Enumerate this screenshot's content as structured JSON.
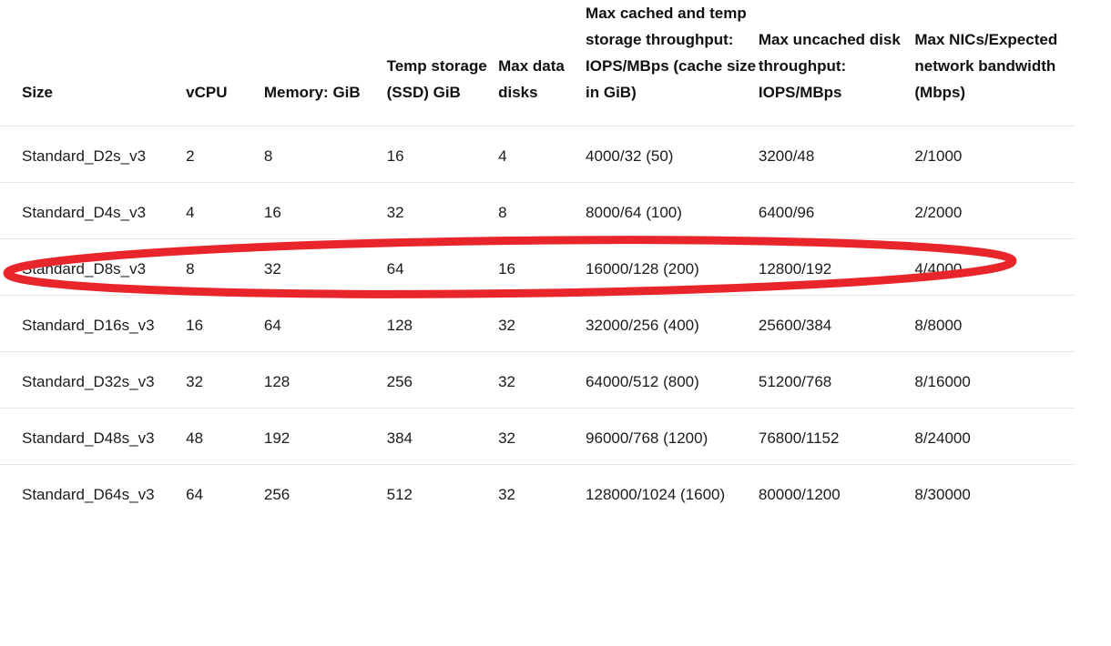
{
  "table": {
    "columns": [
      {
        "key": "size",
        "label": "Size"
      },
      {
        "key": "vcpu",
        "label": "vCPU"
      },
      {
        "key": "memory",
        "label": "Memory: GiB"
      },
      {
        "key": "temp",
        "label": "Temp storage (SSD) GiB"
      },
      {
        "key": "disks",
        "label": "Max data disks"
      },
      {
        "key": "cached",
        "label": "Max cached and temp storage throughput: IOPS/MBps (cache size in GiB)"
      },
      {
        "key": "uncached",
        "label": "Max uncached disk throughput: IOPS/MBps"
      },
      {
        "key": "nics",
        "label": "Max NICs/Expected network bandwidth (Mbps)"
      }
    ],
    "rows": [
      {
        "size": "Standard_D2s_v3",
        "vcpu": "2",
        "memory": "8",
        "temp": "16",
        "disks": "4",
        "cached": "4000/32 (50)",
        "uncached": "3200/48",
        "nics": "2/1000"
      },
      {
        "size": "Standard_D4s_v3",
        "vcpu": "4",
        "memory": "16",
        "temp": "32",
        "disks": "8",
        "cached": "8000/64 (100)",
        "uncached": "6400/96",
        "nics": "2/2000"
      },
      {
        "size": "Standard_D8s_v3",
        "vcpu": "8",
        "memory": "32",
        "temp": "64",
        "disks": "16",
        "cached": "16000/128 (200)",
        "uncached": "12800/192",
        "nics": "4/4000"
      },
      {
        "size": "Standard_D16s_v3",
        "vcpu": "16",
        "memory": "64",
        "temp": "128",
        "disks": "32",
        "cached": "32000/256 (400)",
        "uncached": "25600/384",
        "nics": "8/8000"
      },
      {
        "size": "Standard_D32s_v3",
        "vcpu": "32",
        "memory": "128",
        "temp": "256",
        "disks": "32",
        "cached": "64000/512 (800)",
        "uncached": "51200/768",
        "nics": "8/16000"
      },
      {
        "size": "Standard_D48s_v3",
        "vcpu": "48",
        "memory": "192",
        "temp": "384",
        "disks": "32",
        "cached": "96000/768 (1200)",
        "uncached": "76800/1152",
        "nics": "8/24000"
      },
      {
        "size": "Standard_D64s_v3",
        "vcpu": "64",
        "memory": "256",
        "temp": "512",
        "disks": "32",
        "cached": "128000/1024 (1600)",
        "uncached": "80000/1200",
        "nics": "8/30000"
      }
    ],
    "highlighted_row_index": 2
  },
  "annotation": {
    "shape": "ellipse",
    "target_row": "Standard_D8s_v3",
    "color": "#e8252b",
    "stroke_width": 9
  },
  "colors": {
    "background": "#ffffff",
    "header_text": "#111111",
    "body_text": "#1b1b1b",
    "row_divider": "#e8e8e8",
    "annotation_red": "#e8252b"
  }
}
